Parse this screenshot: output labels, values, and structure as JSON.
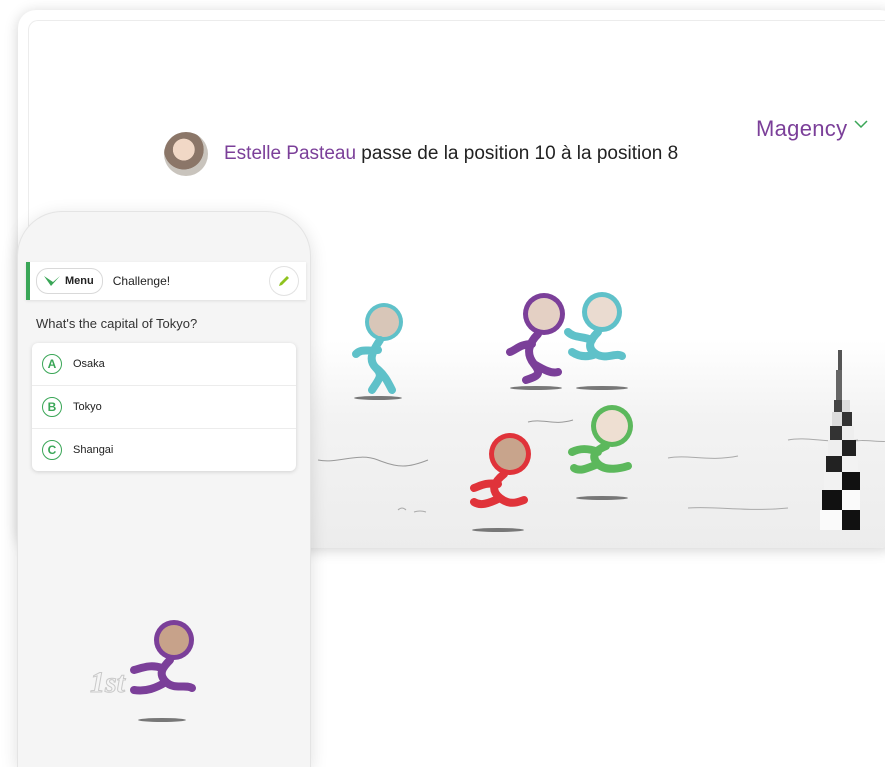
{
  "brand": {
    "logo_text": "Magency"
  },
  "banner": {
    "player_name": "Estelle Pasteau",
    "message": " passe de la position 10 à la position 8"
  },
  "race": {
    "runner_colors": [
      "#5fc1c9",
      "#7b3f99",
      "#5fc1c9",
      "#e0333a",
      "#5cb85c",
      "#7b3f99"
    ]
  },
  "phone": {
    "menu_label": "Menu",
    "title": "Challenge!",
    "question": "What's the capital of Tokyo?",
    "answers": [
      {
        "letter": "A",
        "text": "Osaka"
      },
      {
        "letter": "B",
        "text": "Tokyo"
      },
      {
        "letter": "C",
        "text": "Shangai"
      }
    ],
    "rank": "1st"
  },
  "colors": {
    "accent_green": "#3aa657",
    "brand_purple": "#7b3f99"
  }
}
